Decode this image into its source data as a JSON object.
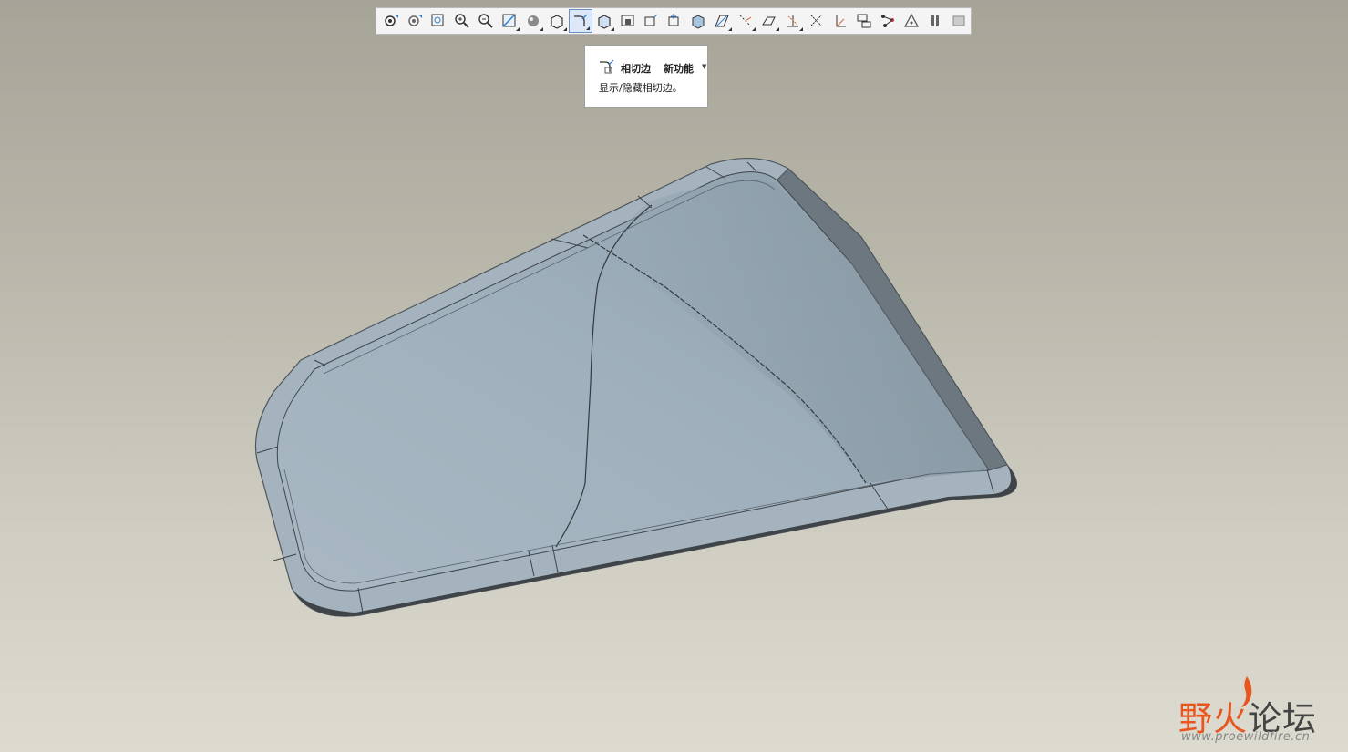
{
  "toolbar": {
    "items": [
      {
        "name": "saved-view-icon"
      },
      {
        "name": "view-manager-icon"
      },
      {
        "name": "refit-icon"
      },
      {
        "name": "zoom-in-icon"
      },
      {
        "name": "zoom-out-icon"
      },
      {
        "name": "repaint-icon"
      },
      {
        "name": "shading-icon"
      },
      {
        "name": "no-hidden-icon"
      },
      {
        "name": "tangent-edges-icon"
      },
      {
        "name": "hidden-line-icon"
      },
      {
        "name": "wireframe-icon"
      },
      {
        "name": "view-orient-icon"
      },
      {
        "name": "spin-center-icon"
      },
      {
        "name": "saved-orientations-icon"
      },
      {
        "name": "datum-planes-icon"
      },
      {
        "name": "datum-axes-icon"
      },
      {
        "name": "datum-points-icon"
      },
      {
        "name": "coordinate-systems-icon"
      },
      {
        "name": "annotations-icon"
      },
      {
        "name": "csys-display-icon"
      },
      {
        "name": "model-tree-icon"
      },
      {
        "name": "network-icon"
      },
      {
        "name": "triangle-warning-icon"
      },
      {
        "name": "pause-icon"
      },
      {
        "name": "next-icon"
      }
    ],
    "active_index": 8
  },
  "tooltip": {
    "title": "相切边",
    "new_feature": "新功能",
    "description": "显示/隐藏相切边。"
  },
  "watermark": {
    "cn_part1": "野",
    "cn_part2": "火",
    "cn_part3": "论坛",
    "url": "www.proewildfire.cn"
  },
  "colors": {
    "surface": "#9eafbb",
    "edge_dark": "#5f6a73",
    "accent": "#e8551f"
  }
}
